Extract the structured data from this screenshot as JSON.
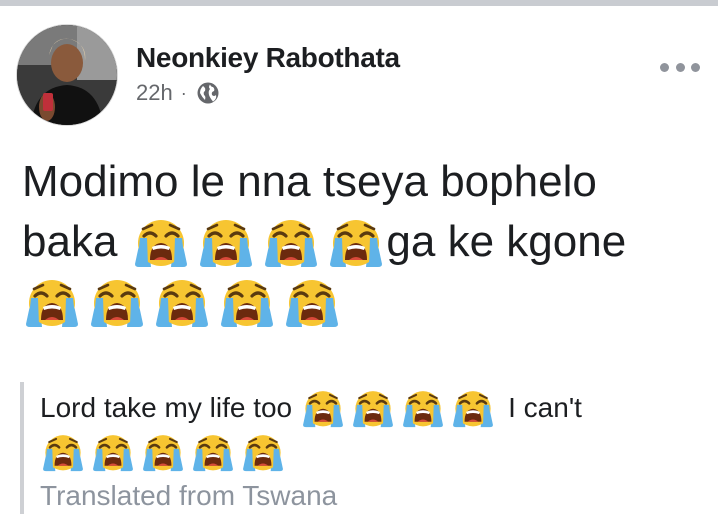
{
  "post": {
    "author": "Neonkiey Rabothata",
    "time": "22h",
    "separator": "·",
    "privacy_icon": "globe-icon",
    "more_icon": "ellipsis-icon",
    "text_line1": "Modimo le nna tseya bophelo",
    "text_line2_prefix": "baka",
    "text_line2_suffix": "ga ke kgone",
    "emoji": "loudly-crying-face"
  },
  "translation": {
    "text_prefix": "Lord take my life too",
    "text_suffix": "I can't",
    "label": "Translated from Tswana"
  },
  "colors": {
    "text": "#1c1e21",
    "secondary": "#65676b",
    "translation_label": "#8d949e",
    "emoji_face": "#f7c531",
    "emoji_tears": "#5fb3e8"
  }
}
